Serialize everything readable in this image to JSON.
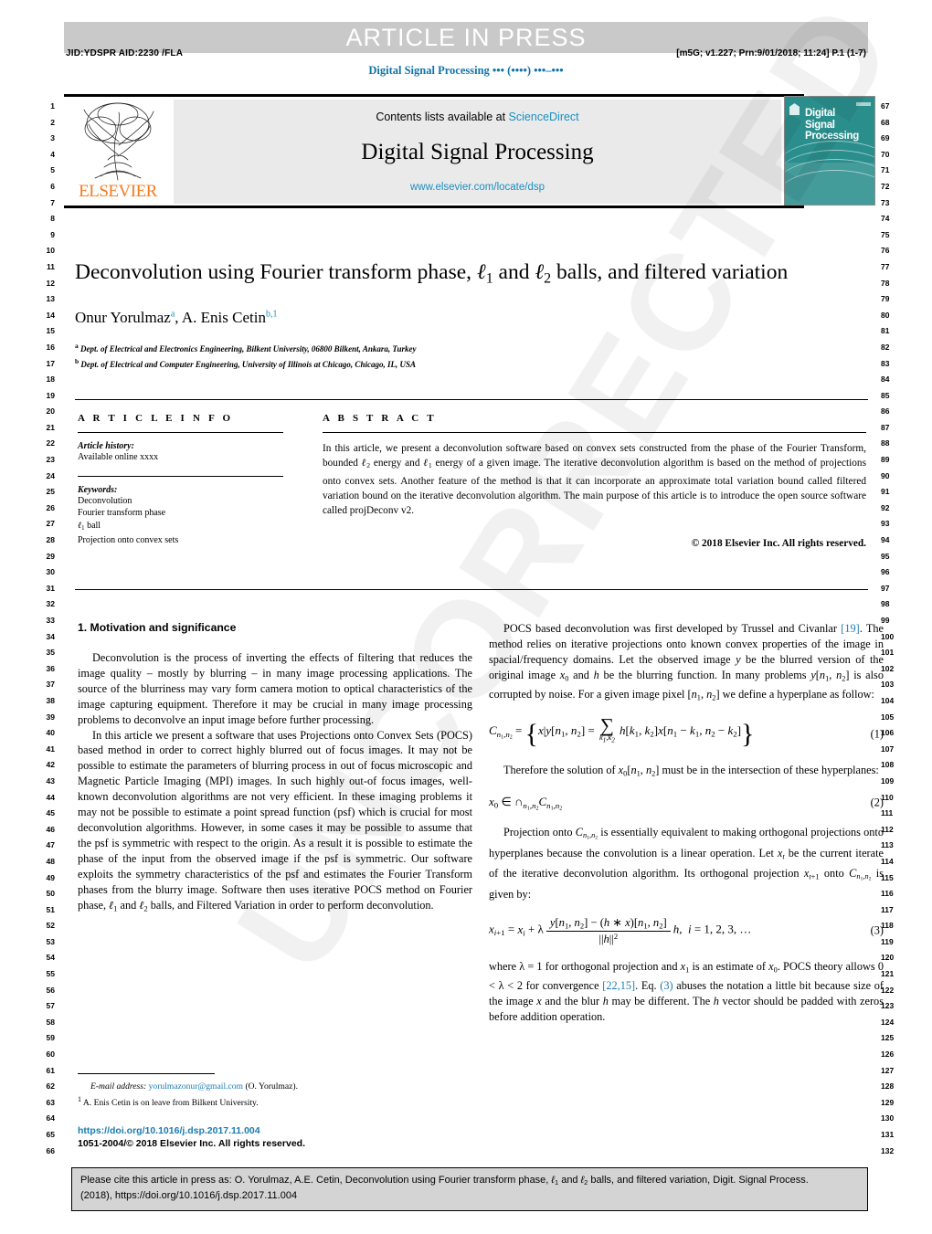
{
  "header": {
    "banner": "ARTICLE IN PRESS",
    "jid_left": "JID:YDSPR   AID:2230 /FLA",
    "jid_right": "[m5G; v1.227; Prn:9/01/2018; 11:24] P.1 (1-7)",
    "journal_running": "Digital Signal Processing ••• (••••) •••–•••"
  },
  "masthead": {
    "publisher": "ELSEVIER",
    "contents_prefix": "Contents lists available at ",
    "contents_link": "ScienceDirect",
    "journal_title": "Digital Signal Processing",
    "journal_url": "www.elsevier.com/locate/dsp",
    "cover_title": "Digital\nSignal\nProcessing"
  },
  "linenumbers": {
    "left_start": 1,
    "left_end": 66,
    "right_start": 67,
    "right_end": 132
  },
  "title_block": {
    "title": "Deconvolution using Fourier transform phase, ℓ1 and ℓ2 balls, and filtered variation",
    "authors": "Onur Yorulmaz a, A. Enis Cetin b,1",
    "affiliation_a": "Dept. of Electrical and Electronics Engineering, Bilkent University, 06800 Bilkent, Ankara, Turkey",
    "affiliation_b": "Dept. of Electrical and Computer Engineering, University of Illinois at Chicago, Chicago, IL, USA"
  },
  "article_info": {
    "heading": "A R T I C L E   I N F O",
    "history_label": "Article history:",
    "history_value": "Available online xxxx",
    "keywords_label": "Keywords:",
    "keywords": [
      "Deconvolution",
      "Fourier transform phase",
      "ℓ1 ball",
      "Projection onto convex sets"
    ]
  },
  "abstract": {
    "heading": "A B S T R A C T",
    "body": "In this article, we present a deconvolution software based on convex sets constructed from the phase of the Fourier Transform, bounded ℓ2 energy and ℓ1 energy of a given image. The iterative deconvolution algorithm is based on the method of projections onto convex sets. Another feature of the method is that it can incorporate an approximate total variation bound called filtered variation bound on the iterative deconvolution algorithm. The main purpose of this article is to introduce the open source software called projDeconv v2.",
    "copyright": "© 2018 Elsevier Inc. All rights reserved."
  },
  "section1": {
    "heading": "1. Motivation and significance",
    "para1": "Deconvolution is the process of inverting the effects of filtering that reduces the image quality – mostly by blurring – in many image processing applications. The source of the blurriness may vary form camera motion to optical characteristics of the image capturing equipment. Therefore it may be crucial in many image processing problems to deconvolve an input image before further processing.",
    "para2": "In this article we present a software that uses Projections onto Convex Sets (POCS) based method in order to correct highly blurred out of focus images. It may not be possible to estimate the parameters of blurring process in out of focus microscopic and Magnetic Particle Imaging (MPI) images. In such highly out-of focus images, well-known deconvolution algorithms are not very efficient. In these imaging problems it may not be possible to estimate a point spread function (psf) which is crucial for most deconvolution algorithms. However, in some cases it may be possible to assume that the psf is symmetric with respect to the origin. As a result it is possible to estimate the phase of the input from the observed image if the psf is symmetric. Our software exploits the symmetry characteristics of the psf and estimates the Fourier Transform phases from the blurry image. Software then uses iterative POCS method on Fourier phase, ℓ1 and ℓ2 balls, and Filtered Variation in order to perform deconvolution."
  },
  "right_column": {
    "para3_a": "POCS based deconvolution was first developed by Trussel and Civanlar ",
    "para3_ref": "[19]",
    "para3_b": ". The method relies on iterative projections onto known convex properties of the image in spacial/frequency domains. Let the observed image y be the blurred version of the original image x0 and h be the blurring function. In many problems y[n1, n2] is also corrupted by noise. For a given image pixel [n1, n2] we define a hyperplane as follow:",
    "eq1_number": "(1)",
    "para4": "Therefore the solution of x0[n1, n2] must be in the intersection of these hyperplanes:",
    "eq2_number": "(2)",
    "para5": "Projection onto Cn1,n2 is essentially equivalent to making orthogonal projections onto hyperplanes because the convolution is a linear operation. Let xt be the current iterate of the iterative deconvolution algorithm. Its orthogonal projection xt+1 onto Cn1,n2 is given by:",
    "eq3_number": "(3)",
    "para6_a": "where λ = 1 for orthogonal projection and x1 is an estimate of x0. POCS theory allows 0 < λ < 2 for convergence ",
    "para6_ref1": "[22,15]",
    "para6_mid": ". Eq. ",
    "para6_ref2": "(3)",
    "para6_b": " abuses the notation a little bit because size of the image x and the blur h may be different. The h vector should be padded with zeros before addition operation."
  },
  "footnotes": {
    "email_label": "E-mail address:",
    "email_link": "yorulmazonur@gmail.com",
    "email_suffix": "(O. Yorulmaz).",
    "note1_marker": "1",
    "note1_text": "A. Enis Cetin is on leave from Bilkent University.",
    "doi": "https://doi.org/10.1016/j.dsp.2017.11.004",
    "copyright_line": "1051-2004/© 2018 Elsevier Inc. All rights reserved."
  },
  "cite_box": {
    "line1": "Please cite this article in press as: O. Yorulmaz, A.E. Cetin, Deconvolution using Fourier transform phase, ℓ1 and ℓ2 balls, and filtered variation, Digit. Signal Process.",
    "line2": "(2018), https://doi.org/10.1016/j.dsp.2017.11.004"
  },
  "watermark": {
    "text": "UNCORRECTED PROOF"
  },
  "colors": {
    "link": "#1a7bb0",
    "sciencedirect": "#1a8fc1",
    "elsevier_orange": "#f47b20",
    "cover_teal": "#2a8e8c",
    "banner_grey": "#c9c9c9"
  }
}
